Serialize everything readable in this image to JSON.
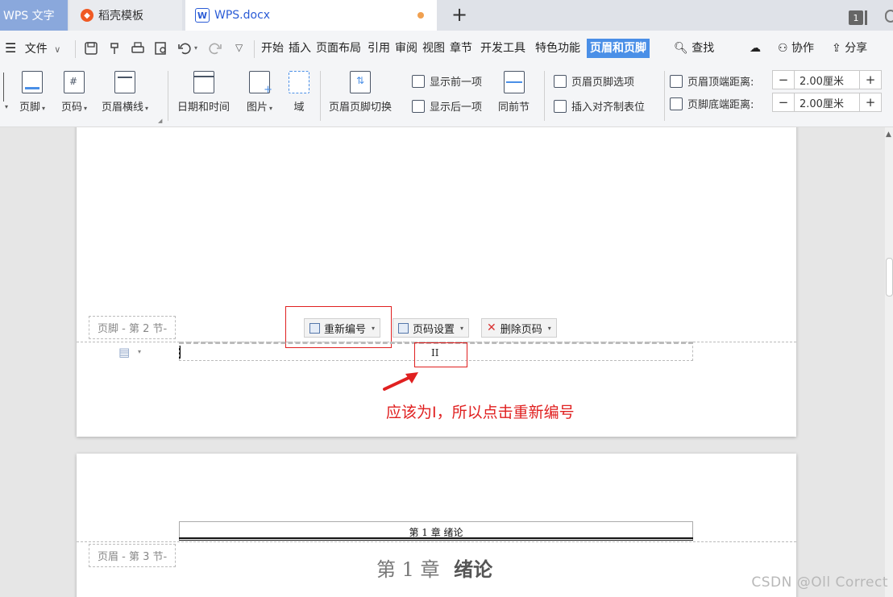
{
  "tabs": {
    "app": "WPS 文字",
    "template": "稻壳模板",
    "doc": "WPS.docx",
    "window_count": "1"
  },
  "menu": {
    "file": "文件",
    "items": [
      "开始",
      "插入",
      "页面布局",
      "引用",
      "审阅",
      "视图",
      "章节",
      "开发工具",
      "特色功能"
    ],
    "active": "页眉和页脚",
    "search": "查找",
    "collab": "协作",
    "share": "分享"
  },
  "ribbon": {
    "footer": "页脚",
    "page_number": "页码",
    "header_line": "页眉横线",
    "date_time": "日期和时间",
    "picture": "图片",
    "field": "域",
    "switch_hf": "页眉页脚切换",
    "show_prev": "显示前一项",
    "show_next": "显示后一项",
    "same_as_prev": "同前节",
    "hf_options": "页眉页脚选项",
    "insert_align_tab": "插入对齐制表位",
    "header_top_dist": "页眉顶端距离:",
    "footer_bottom_dist": "页脚底端距离:",
    "header_top_value": "2.00厘米",
    "footer_bottom_value": "2.00厘米"
  },
  "doc": {
    "footer_tag": "页脚 - 第 2 节-",
    "renumber": "重新编号",
    "page_num_settings": "页码设置",
    "delete_page_num": "删除页码",
    "page_number_value": "II",
    "annotation": "应该为I，所以点击重新编号",
    "header_text": "第 1 章  绪论",
    "header_tag": "页眉 - 第 3 节-",
    "chapter_title": "第 1 章",
    "chapter_title_bold": "绪论"
  },
  "watermark": "CSDN @Oll Correct",
  "colors": {
    "accent": "#4a8fe7",
    "annotation_red": "#e02020",
    "tab_wps": "#8aa8dc"
  }
}
